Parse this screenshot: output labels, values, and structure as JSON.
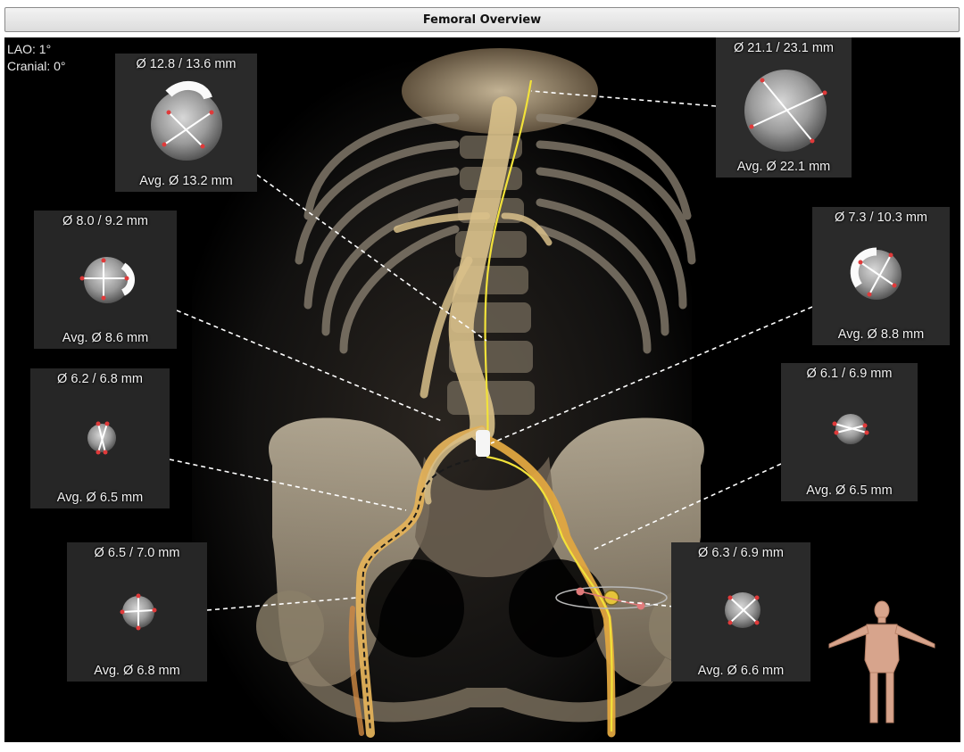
{
  "window": {
    "title": "Femoral Overview"
  },
  "orientation": {
    "lao": "LAO: 1°",
    "cranial": "Cranial: 0°"
  },
  "measurements": {
    "m1": {
      "diameters": "Ø 12.8 / 13.6 mm",
      "average": "Avg. Ø 13.2 mm"
    },
    "m2": {
      "diameters": "Ø 21.1 / 23.1 mm",
      "average": "Avg. Ø 22.1 mm"
    },
    "m3": {
      "diameters": "Ø 8.0 / 9.2 mm",
      "average": "Avg. Ø 8.6 mm"
    },
    "m4": {
      "diameters": "Ø 7.3 / 10.3 mm",
      "average": "Avg. Ø 8.8 mm"
    },
    "m5": {
      "diameters": "Ø 6.2 / 6.8 mm",
      "average": "Avg. Ø 6.5 mm"
    },
    "m6": {
      "diameters": "Ø 6.1 / 6.9 mm",
      "average": "Avg. Ø 6.5 mm"
    },
    "m7": {
      "diameters": "Ø 6.5 / 7.0 mm",
      "average": "Avg. Ø 6.8 mm"
    },
    "m8": {
      "diameters": "Ø 6.3 / 6.9 mm",
      "average": "Avg. Ø 6.6 mm"
    }
  },
  "colors": {
    "background": "#000000",
    "bone": "#b7aa92",
    "vessel": "#e7cf8f",
    "centerline": "#f2e23a",
    "caliper_end": "#e03a3a",
    "leader_line": "#ffffff",
    "avatar_skin": "#d7a48c"
  },
  "icons": {
    "orientation_avatar": "human-body-icon"
  }
}
